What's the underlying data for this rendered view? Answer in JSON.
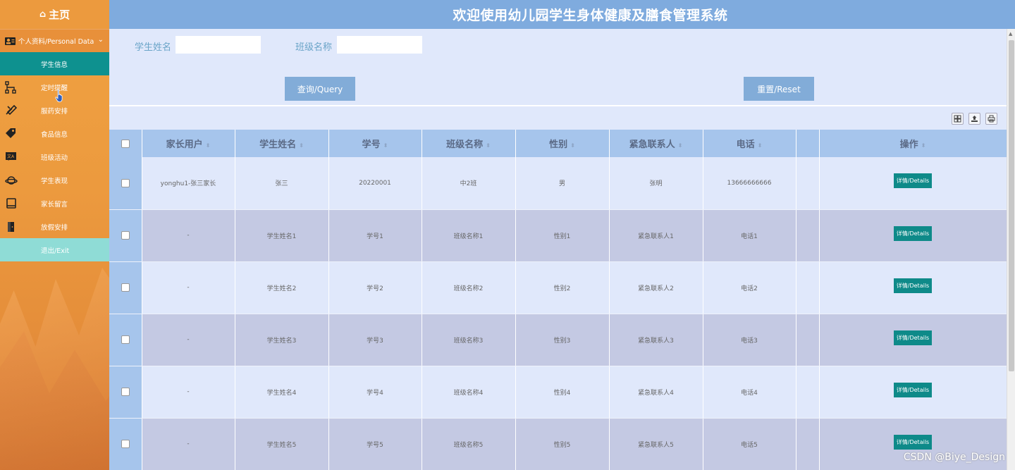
{
  "sidebar": {
    "home_label": "主页",
    "personal_label": "个人资料/Personal Data",
    "items": [
      {
        "label": "学生信息",
        "icon": "none",
        "active": true
      },
      {
        "label": "定时提醒",
        "icon": "sitemap-icon"
      },
      {
        "label": "服药安排",
        "icon": "tools-icon"
      },
      {
        "label": "食品信息",
        "icon": "tag-icon"
      },
      {
        "label": "班级活动",
        "icon": "language-icon"
      },
      {
        "label": "学生表现",
        "icon": "planet-icon"
      },
      {
        "label": "家长留言",
        "icon": "book-icon"
      },
      {
        "label": "放假安排",
        "icon": "door-icon"
      }
    ],
    "exit_label": "退出/Exit"
  },
  "header": {
    "title": "欢迎使用幼儿园学生身体健康及膳食管理系统"
  },
  "search": {
    "name_label": "学生姓名",
    "name_value": "",
    "class_label": "班级名称",
    "class_value": "",
    "query_label": "查询/Query",
    "reset_label": "重置/Reset"
  },
  "table": {
    "columns": [
      "家长用户",
      "学生姓名",
      "学号",
      "班级名称",
      "性别",
      "紧急联系人",
      "电话",
      "",
      "操作"
    ],
    "rows": [
      {
        "parent": "yonghu1-张三家长",
        "name": "张三",
        "id": "20220001",
        "class": "中2班",
        "gender": "男",
        "contact": "张明",
        "phone": "13666666666"
      },
      {
        "parent": "-",
        "name": "学生姓名1",
        "id": "学号1",
        "class": "班级名称1",
        "gender": "性别1",
        "contact": "紧急联系人1",
        "phone": "电话1"
      },
      {
        "parent": "-",
        "name": "学生姓名2",
        "id": "学号2",
        "class": "班级名称2",
        "gender": "性别2",
        "contact": "紧急联系人2",
        "phone": "电话2"
      },
      {
        "parent": "-",
        "name": "学生姓名3",
        "id": "学号3",
        "class": "班级名称3",
        "gender": "性别3",
        "contact": "紧急联系人3",
        "phone": "电话3"
      },
      {
        "parent": "-",
        "name": "学生姓名4",
        "id": "学号4",
        "class": "班级名称4",
        "gender": "性别4",
        "contact": "紧急联系人4",
        "phone": "电话4"
      },
      {
        "parent": "-",
        "name": "学生姓名5",
        "id": "学号5",
        "class": "班级名称5",
        "gender": "性别5",
        "contact": "紧急联系人5",
        "phone": "电话5"
      }
    ],
    "details_label": "详情/Details"
  },
  "watermark": "CSDN @Biye_Design",
  "colors": {
    "sidebar_orange": "#ec9a3e",
    "active_teal": "#0e918f",
    "exit_mint": "#8fdcd6",
    "header_blue": "#7fabde",
    "button_blue": "#82acd8"
  }
}
